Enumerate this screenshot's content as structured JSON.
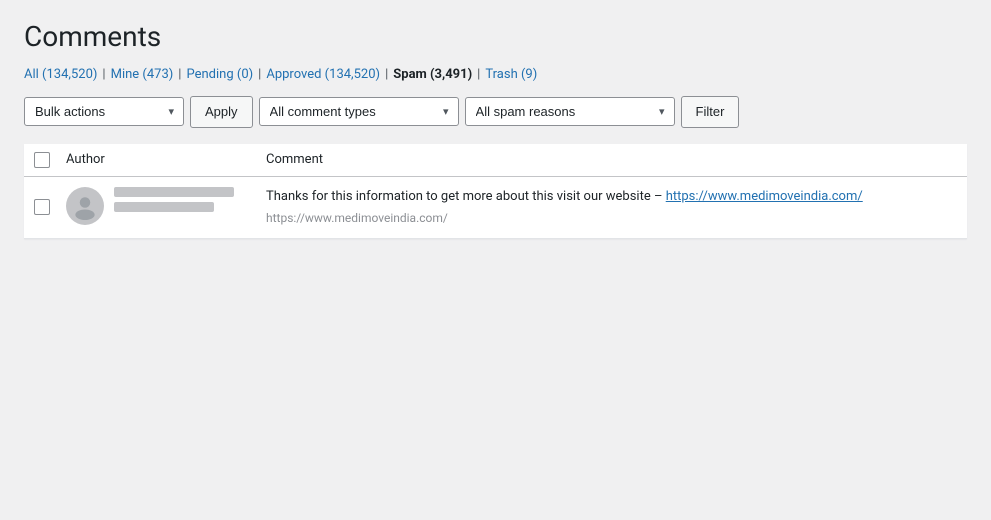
{
  "page": {
    "title": "Comments"
  },
  "filters": {
    "all_label": "All (134,520)",
    "mine_label": "Mine (473)",
    "pending_label": "Pending (0)",
    "approved_label": "Approved (134,520)",
    "spam_label": "Spam (3,491)",
    "trash_label": "Trash (9)"
  },
  "toolbar": {
    "bulk_actions_label": "Bulk actions",
    "apply_label": "Apply",
    "comment_types_label": "All comment types",
    "spam_reasons_label": "All spam reasons",
    "filter_label": "Filter"
  },
  "table": {
    "col_author": "Author",
    "col_comment": "Comment",
    "rows": [
      {
        "comment_text": "Thanks for this information to get more about this visit our website – ",
        "comment_link": "https://www.medimoveindia.com/",
        "comment_url": "https://www.medimoveindia.com/"
      }
    ]
  }
}
